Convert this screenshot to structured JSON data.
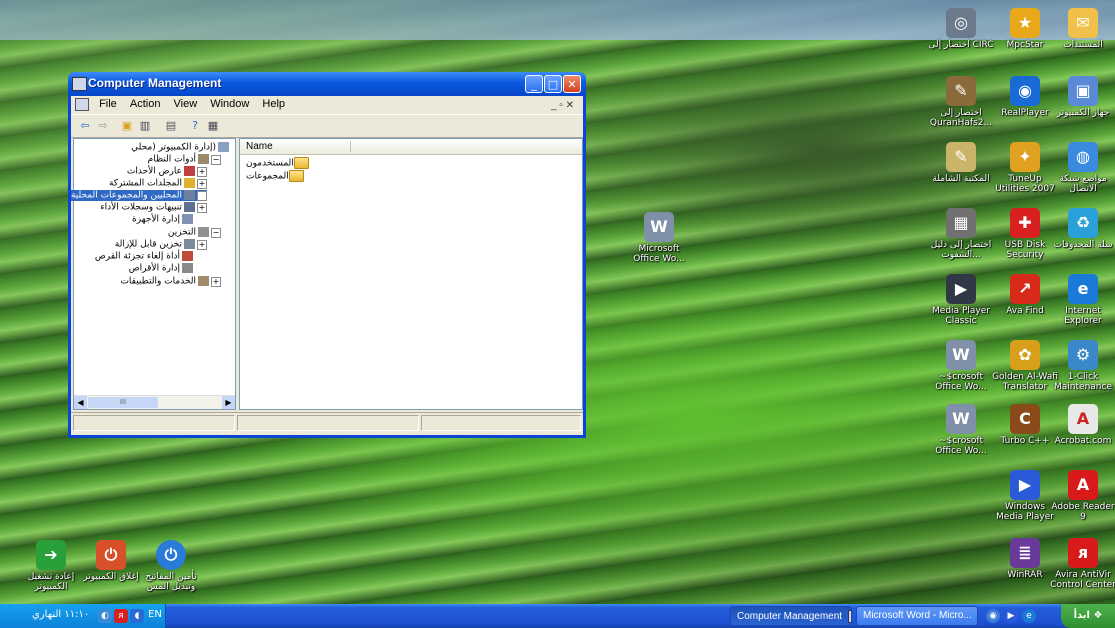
{
  "window": {
    "title": "Computer Management",
    "menu": [
      "File",
      "Action",
      "View",
      "Window",
      "Help"
    ],
    "tree": [
      {
        "label": "(إدارة الكمبيوتر (محلي",
        "level": 0,
        "expander": "",
        "selected": false
      },
      {
        "label": "أدوات النظام",
        "level": 1,
        "expander": "−",
        "selected": false
      },
      {
        "label": "عارض الأحداث",
        "level": 2,
        "expander": "+",
        "selected": false
      },
      {
        "label": "المجلدات المشتركة",
        "level": 2,
        "expander": "+",
        "selected": false
      },
      {
        "label": "المحليين والمجموعات المحلية",
        "level": 2,
        "expander": "+",
        "selected": true
      },
      {
        "label": "تنبيهات وسجلات الأداء",
        "level": 2,
        "expander": "+",
        "selected": false
      },
      {
        "label": "إدارة الأجهزة",
        "level": 2,
        "expander": "",
        "selected": false
      },
      {
        "label": "التخزين",
        "level": 1,
        "expander": "−",
        "selected": false
      },
      {
        "label": "تخزين قابل للإزالة",
        "level": 2,
        "expander": "+",
        "selected": false
      },
      {
        "label": "أداة إلغاء تجزئة القرص",
        "level": 2,
        "expander": "",
        "selected": false
      },
      {
        "label": "إدارة الأقراص",
        "level": 2,
        "expander": "",
        "selected": false
      },
      {
        "label": "الخدمات والتطبيقات",
        "level": 1,
        "expander": "+",
        "selected": false
      }
    ],
    "scroll_mid": "III",
    "list_header": "Name",
    "list_items": [
      "المستخدمون",
      "المجموعات"
    ]
  },
  "desktop_icons": [
    {
      "label": "اختصار إلى CIRC",
      "glyph": "◎",
      "color": "#6b7b8c"
    },
    {
      "label": "MpcStar",
      "glyph": "★",
      "color": "#e8a81a"
    },
    {
      "label": "المستندات",
      "glyph": "✉",
      "color": "#f0c04a"
    },
    {
      "label": "اختصار إلى QuranHafs2...",
      "glyph": "✎",
      "color": "#8a6a3a"
    },
    {
      "label": "RealPlayer",
      "glyph": "◉",
      "color": "#1a6ad6"
    },
    {
      "label": "جهاز الكمبيوتر",
      "glyph": "▣",
      "color": "#5a8ad6"
    },
    {
      "label": "المكتبة الشاملة",
      "glyph": "✎",
      "color": "#c9b46a"
    },
    {
      "label": "TuneUp Utilities 2007",
      "glyph": "✦",
      "color": "#e0a020"
    },
    {
      "label": "مواضع شبكة الاتصال",
      "glyph": "◍",
      "color": "#3a8ae0"
    },
    {
      "label": "اختصار إلى دليل الشفوت...",
      "glyph": "▦",
      "color": "#707070"
    },
    {
      "label": "USB Disk Security",
      "glyph": "✚",
      "color": "#d82020"
    },
    {
      "label": "سلة المحذوفات",
      "glyph": "♻",
      "color": "#2aa0d8"
    },
    {
      "label": "Media Player Classic",
      "glyph": "▶",
      "color": "#303848"
    },
    {
      "label": "Ava Find",
      "glyph": "↗",
      "color": "#d82a1a"
    },
    {
      "label": "Internet Explorer",
      "glyph": "e",
      "color": "#1a7ad8"
    },
    {
      "label": "~$crosoft Office Wo...",
      "glyph": "W",
      "color": "#8090a8"
    },
    {
      "label": "Golden Al-Wafi Translator",
      "glyph": "✿",
      "color": "#d8a01a"
    },
    {
      "label": "1-Click Maintenance",
      "glyph": "⚙",
      "color": "#3a88c8"
    },
    {
      "label": "~$crosoft Office Wo...",
      "glyph": "W",
      "color": "#8090a8"
    },
    {
      "label": "Turbo C++",
      "glyph": "C",
      "color": "#8a4a1a"
    },
    {
      "label": "Acrobat.com",
      "glyph": "A",
      "color": "#e8e8e8"
    },
    {
      "label": "Windows Media Player",
      "glyph": "▶",
      "color": "#2a5ad8"
    },
    {
      "label": "Adobe Reader 9",
      "glyph": "A",
      "color": "#d81a1a"
    },
    {
      "label": "WinRAR",
      "glyph": "≣",
      "color": "#6a3a9a"
    },
    {
      "label": "Avira AntiVir Control Center",
      "glyph": "ᴙ",
      "color": "#d81a1a"
    },
    {
      "label": "Microsoft Office Wo...",
      "glyph": "W",
      "color": "#8090a8"
    },
    {
      "label": "إعادة تشغيل الكمبيوتر",
      "glyph": "➔",
      "color": "#2aa03a"
    },
    {
      "label": "إغلاق الكمبيوتر",
      "glyph": "⏻",
      "color": "#d8502a"
    },
    {
      "label": "تأمين المفاتيح وتبديل المس",
      "glyph": "⏻",
      "color": "#2a7ad8"
    }
  ],
  "taskbar": {
    "clock": "١١:١٠ النهاري",
    "lang": "EN",
    "buttons": [
      "Computer Management",
      "Microsoft Word - Micro..."
    ],
    "start": "ابدأ"
  }
}
